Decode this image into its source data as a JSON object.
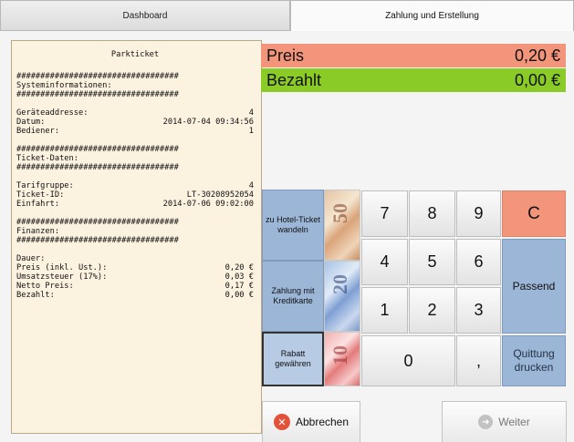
{
  "tabs": [
    "Dashboard",
    "Zahlung und Erstellung"
  ],
  "receipt": {
    "title": "Parkticket",
    "hash": "##################################",
    "sections": {
      "system": "Systeminformationen:",
      "ticket": "Ticket-Daten:",
      "finance": "Finanzen:"
    },
    "system_rows": [
      {
        "label": "Geräteaddresse:",
        "value": "4"
      },
      {
        "label": "Datum:",
        "value": "2014-07-04 09:34:56"
      },
      {
        "label": "Bediener:",
        "value": "1"
      }
    ],
    "ticket_rows": [
      {
        "label": "Tarifgruppe:",
        "value": "4"
      },
      {
        "label": "Ticket-ID:",
        "value": "LT-30208952054"
      },
      {
        "label": "Einfahrt:",
        "value": "2014-07-06 09:02:00"
      }
    ],
    "finance_rows": [
      {
        "label": "Dauer:",
        "value": ""
      },
      {
        "label": "Preis (inkl. Ust.):",
        "value": "0,20 €"
      },
      {
        "label": "Umsatzsteuer (17%):",
        "value": "0,03 €"
      },
      {
        "label": "Netto Preis:",
        "value": "0,17 €"
      },
      {
        "label": "Bezahlt:",
        "value": "0,00 €"
      }
    ]
  },
  "price": {
    "label": "Preis",
    "value": "0,20 €",
    "color": "#f3957b"
  },
  "paid": {
    "label": "Bezahlt",
    "value": "0,00 €",
    "color": "#8bcb28"
  },
  "actions": {
    "hotel": "zu Hotel-Ticket wandeln",
    "card": "Zahlung mit Kreditkarte",
    "discount": "Rabatt gewähren"
  },
  "banknotes": [
    "50",
    "20",
    "10"
  ],
  "keypad": {
    "k7": "7",
    "k8": "8",
    "k9": "9",
    "k4": "4",
    "k5": "5",
    "k6": "6",
    "k1": "1",
    "k2": "2",
    "k3": "3",
    "k0": "0",
    "comma": ",",
    "clear": "C",
    "exact": "Passend",
    "receipt": "Quittung drucken"
  },
  "buttons": {
    "cancel": "Abbrechen",
    "next": "Weiter"
  },
  "icons": {
    "cancel": "close-circle-icon",
    "next": "arrow-right-circle-icon"
  }
}
